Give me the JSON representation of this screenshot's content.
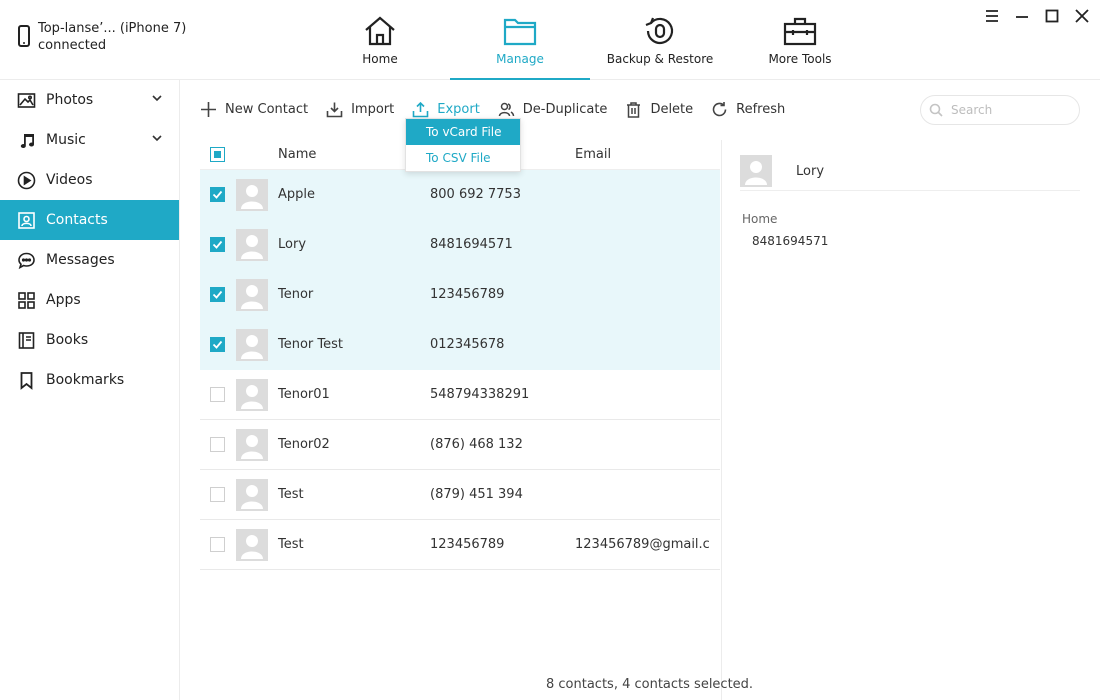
{
  "device": {
    "name": "Top-lanse’... (iPhone 7)",
    "status": "connected"
  },
  "nav": {
    "home": "Home",
    "manage": "Manage",
    "backup": "Backup & Restore",
    "tools": "More Tools"
  },
  "sidebar": {
    "items": [
      {
        "label": "Photos",
        "icon": "photo-icon"
      },
      {
        "label": "Music",
        "icon": "music-note-icon"
      },
      {
        "label": "Videos",
        "icon": "play-circle-icon"
      },
      {
        "label": "Contacts",
        "icon": "contact-card-icon"
      },
      {
        "label": "Messages",
        "icon": "chat-bubble-icon"
      },
      {
        "label": "Apps",
        "icon": "apps-grid-icon"
      },
      {
        "label": "Books",
        "icon": "book-icon"
      },
      {
        "label": "Bookmarks",
        "icon": "bookmark-icon"
      }
    ]
  },
  "toolbar": {
    "new_contact": "New Contact",
    "import": "Import",
    "export": "Export",
    "deduplicate": "De-Duplicate",
    "delete": "Delete",
    "refresh": "Refresh"
  },
  "search": {
    "placeholder": "Search"
  },
  "export_menu": {
    "vcard": "To vCard File",
    "csv": "To CSV File"
  },
  "table": {
    "headers": {
      "name": "Name",
      "email": "Email"
    },
    "rows": [
      {
        "name": "Apple",
        "phone": "800 692 7753",
        "email": "",
        "checked": true
      },
      {
        "name": "Lory",
        "phone": "8481694571",
        "email": "",
        "checked": true
      },
      {
        "name": "Tenor",
        "phone": "123456789",
        "email": "",
        "checked": true
      },
      {
        "name": "Tenor Test",
        "phone": "012345678",
        "email": "",
        "checked": true
      },
      {
        "name": "Tenor01",
        "phone": "548794338291",
        "email": "",
        "checked": false
      },
      {
        "name": "Tenor02",
        "phone": "(876) 468 132",
        "email": "",
        "checked": false
      },
      {
        "name": "Test",
        "phone": "(879) 451 394",
        "email": "",
        "checked": false
      },
      {
        "name": "Test",
        "phone": "123456789",
        "email": "123456789@gmail.c...",
        "checked": false
      }
    ]
  },
  "detail": {
    "name": "Lory",
    "phone_type": "Home",
    "phone": "8481694571"
  },
  "status": "8 contacts, 4 contacts selected.",
  "colors": {
    "accent": "#1fa9c6",
    "selected_row": "#e8f7fa"
  }
}
